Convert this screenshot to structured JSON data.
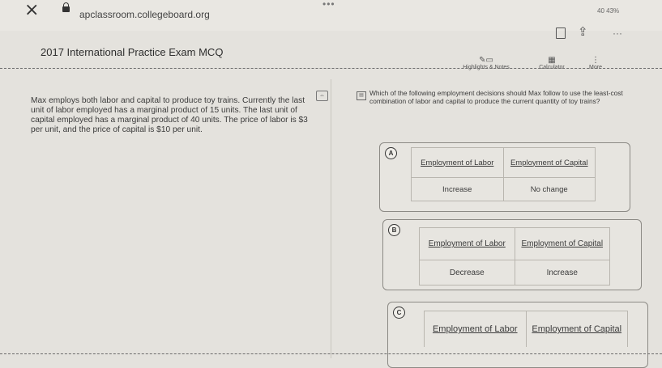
{
  "browser": {
    "close_glyph": "×",
    "url": "apclassroom.collegeboard.org",
    "tab_dots": "•••",
    "status": "40 43%",
    "more_glyph": "···"
  },
  "exam": {
    "title": "2017 International Practice Exam MCQ"
  },
  "tools": {
    "highlights": {
      "icon": "pen-icon",
      "label": "Highlights & Notes"
    },
    "calculator": {
      "icon": "calculator-icon",
      "label": "Calculator"
    },
    "more": {
      "icon": "vertical-dots-icon",
      "label": "More"
    }
  },
  "passage": {
    "text": "Max employs both labor and capital to produce toy trains. Currently the last unit of labor employed has a marginal product of 15 units. The last unit of capital employed has a marginal product of 40 units. The price of labor is $3 per unit, and the price of capital is $10 per unit."
  },
  "question": {
    "text": "Which of the following employment decisions should Max follow to use the least-cost combination of labor and capital to produce the current quantity of toy trains?"
  },
  "options": [
    {
      "letter": "A",
      "header_labor": "Employment of Labor",
      "header_capital": "Employment of Capital",
      "labor": "Increase",
      "capital": "No change"
    },
    {
      "letter": "B",
      "header_labor": "Employment of Labor",
      "header_capital": "Employment of Capital",
      "labor": "Decrease",
      "capital": "Increase"
    },
    {
      "letter": "C",
      "header_labor": "Employment of Labor",
      "header_capital": "Employment of Capital"
    }
  ]
}
